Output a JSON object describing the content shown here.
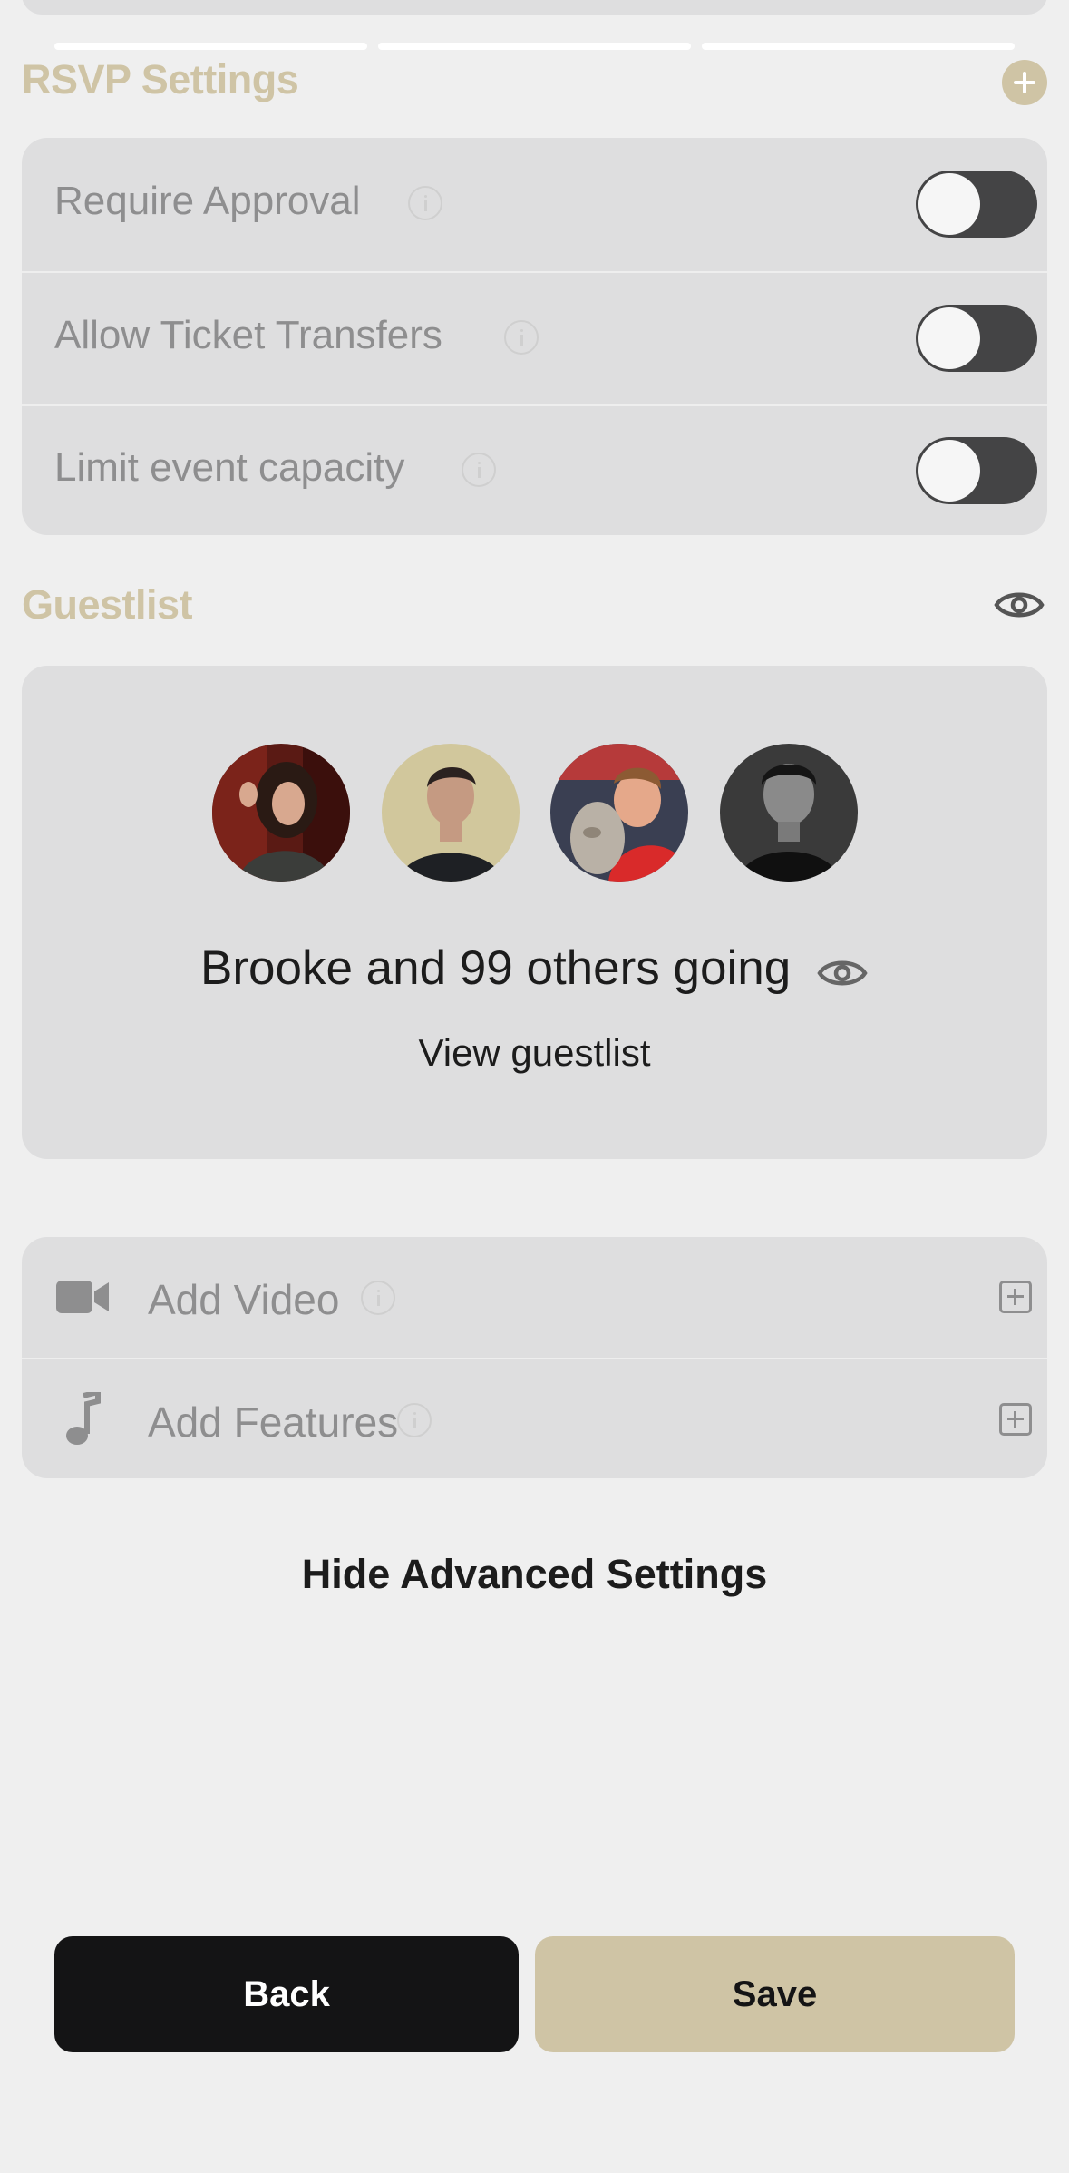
{
  "rsvp": {
    "title": "RSVP Settings",
    "rows": [
      {
        "label": "Require Approval",
        "enabled": false
      },
      {
        "label": "Allow Ticket Transfers",
        "enabled": false
      },
      {
        "label": "Limit event capacity",
        "enabled": false
      }
    ]
  },
  "guestlist": {
    "title": "Guestlist",
    "going_text": "Brooke and 99 others going",
    "view_link": "View guestlist"
  },
  "features": {
    "items": [
      {
        "label": "Add Video",
        "icon": "video-camera-icon"
      },
      {
        "label": "Add Features",
        "icon": "music-note-icon"
      }
    ]
  },
  "advanced": {
    "toggle_label": "Hide Advanced Settings"
  },
  "footer": {
    "back_label": "Back",
    "save_label": "Save"
  },
  "colors": {
    "accent": "#cfc4a5",
    "card": "#dededf",
    "background": "#efefef",
    "dark": "#141415"
  }
}
